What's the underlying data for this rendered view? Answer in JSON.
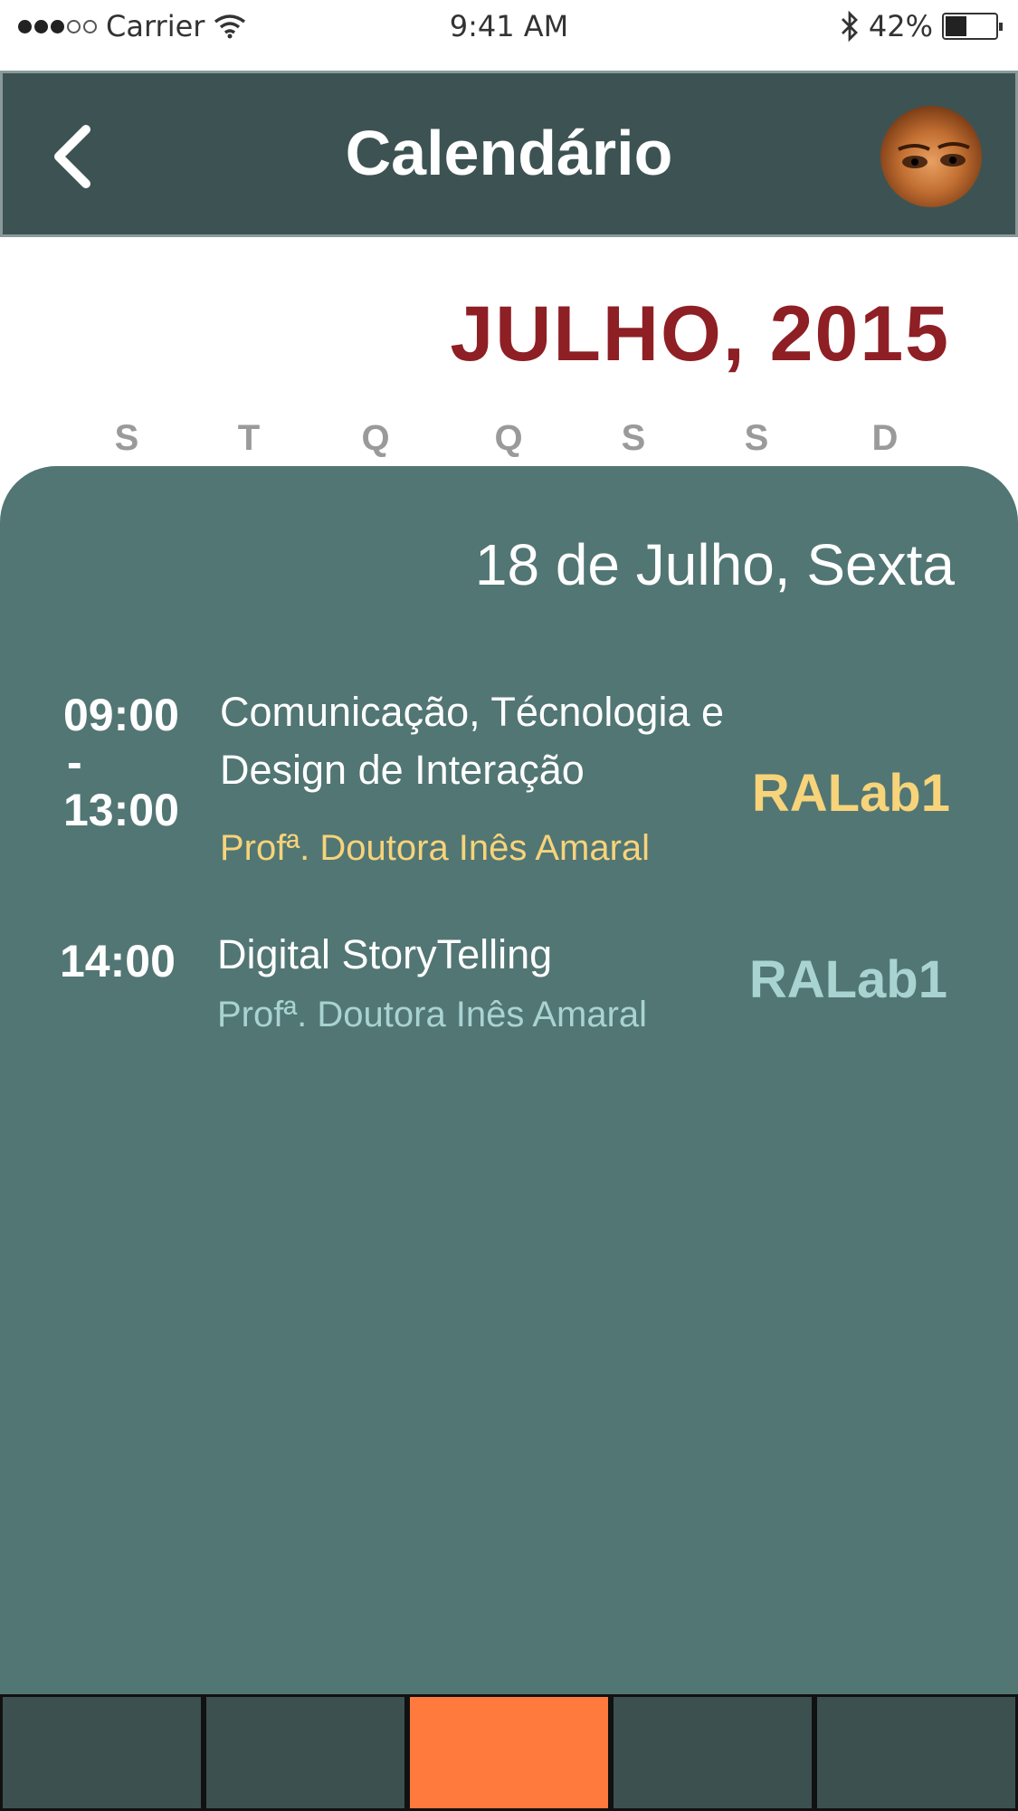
{
  "status_bar": {
    "carrier": "Carrier",
    "time": "9:41 AM",
    "battery_percent": "42%",
    "battery_level": 0.42
  },
  "header": {
    "title": "Calendário",
    "back_icon": "chevron-left-icon",
    "avatar_icon": "user-avatar"
  },
  "calendar": {
    "month_title": "JULHO, 2015",
    "weekdays": [
      "S",
      "T",
      "Q",
      "Q",
      "S",
      "S",
      "D"
    ]
  },
  "day": {
    "title": "18 de Julho, Sexta",
    "events": [
      {
        "time_start": "09:00",
        "time_separator": "-",
        "time_end": "13:00",
        "title_line1": "Comunicação, Técnologia e",
        "title_line2": "Design de Interação",
        "teacher": "Profª. Doutora Inês Amaral",
        "room": "RALab1",
        "accent_color": "#f7d37a"
      },
      {
        "time_start": "14:00",
        "title_line1": "Digital StoryTelling",
        "teacher": "Profª. Doutora Inês Amaral",
        "room": "RALab1",
        "accent_color": "#a9d3d1"
      }
    ]
  },
  "tab_bar": {
    "tabs": [
      {
        "active": false
      },
      {
        "active": false
      },
      {
        "active": true
      },
      {
        "active": false
      },
      {
        "active": false
      }
    ],
    "active_color": "#ff7a3c",
    "inactive_color": "#3d5050"
  },
  "colors": {
    "header_bg": "#3d5353",
    "panel_bg": "#517674",
    "month_title": "#8e1f24"
  }
}
